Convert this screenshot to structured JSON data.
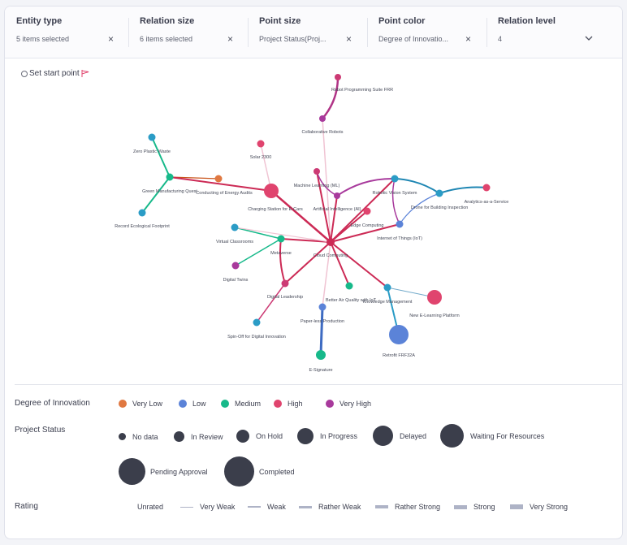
{
  "filters": [
    {
      "title": "Entity type",
      "value": "5 items selected",
      "control": "×"
    },
    {
      "title": "Relation size",
      "value": "6 items selected",
      "control": "×"
    },
    {
      "title": "Point size",
      "value": "Project Status(Proj...",
      "control": "×"
    },
    {
      "title": "Point color",
      "value": "Degree of Innovatio...",
      "control": "×"
    },
    {
      "title": "Relation level",
      "value": "4",
      "control": "chevron-down-icon"
    }
  ],
  "graph": {
    "start_point_label": "Set start point",
    "nodes": [
      {
        "id": "robot-programming-suite",
        "label": "Robot Programming Suite FRR",
        "color": "#cc3a74"
      },
      {
        "id": "collaborative-robots",
        "label": "Collaborative Robots",
        "color": "#a83a9c"
      },
      {
        "id": "zero-plastic-waste",
        "label": "Zero Plastic Waste",
        "color": "#2b9cc6"
      },
      {
        "id": "solar-2300",
        "label": "Solar 2300",
        "color": "#e0446e"
      },
      {
        "id": "green-manufacturing",
        "label": "Green Manufacturing Quest",
        "color": "#17b98a"
      },
      {
        "id": "conducting-energy-audits",
        "label": "Conducting of Energy Audits",
        "color": "#e07841"
      },
      {
        "id": "charging-station",
        "label": "Charging Station for E-Cars",
        "color": "#e0446e"
      },
      {
        "id": "record-ecological-footprint",
        "label": "Record Ecological Footprint",
        "color": "#2b9cc6"
      },
      {
        "id": "machine-learning",
        "label": "Machine Learning (ML)",
        "color": "#cc3a74"
      },
      {
        "id": "artificial-intelligence",
        "label": "Artificial Intelligence (AI)",
        "color": "#a83a9c"
      },
      {
        "id": "robotic-vision-system",
        "label": "Robotic Vision System",
        "color": "#2b9cc6"
      },
      {
        "id": "drone-building-inspection",
        "label": "Drone for Building Inspection",
        "color": "#2b9cc6"
      },
      {
        "id": "analytics-as-a-service",
        "label": "Analytics-as-a-Service",
        "color": "#e0446e"
      },
      {
        "id": "edge-computing",
        "label": "Edge Computing",
        "color": "#e0446e"
      },
      {
        "id": "internet-of-things",
        "label": "Internet of Things (IoT)",
        "color": "#5b83d8"
      },
      {
        "id": "virtual-classrooms",
        "label": "Virtual Classrooms",
        "color": "#2b9cc6"
      },
      {
        "id": "metaverse",
        "label": "Metaverse",
        "color": "#17b98a"
      },
      {
        "id": "cloud-computing",
        "label": "Cloud Computing",
        "color": "#cc2a55"
      },
      {
        "id": "digital-twins",
        "label": "Digital Twins",
        "color": "#a83a9c"
      },
      {
        "id": "digital-leadership",
        "label": "Digital Leadership",
        "color": "#cc3a74"
      },
      {
        "id": "better-air-quality",
        "label": "Better Air Quality with IoT",
        "color": "#17b98a"
      },
      {
        "id": "knowledge-management",
        "label": "Knowledge Management",
        "color": "#2b9cc6"
      },
      {
        "id": "new-e-learning-platform",
        "label": "New E-Learning Platform",
        "color": "#e0446e"
      },
      {
        "id": "paper-less-production",
        "label": "Paper-less Production",
        "color": "#5b83d8"
      },
      {
        "id": "spin-off-digital-innovation",
        "label": "Spin-Off for Digital Innovation",
        "color": "#2b9cc6"
      },
      {
        "id": "retrofit-frf-32a",
        "label": "Retrofit FRF32A",
        "color": "#5b83d8"
      },
      {
        "id": "e-signature",
        "label": "E-Signature",
        "color": "#17b98a"
      }
    ]
  },
  "legend": {
    "degree_of_innovation": {
      "title": "Degree of Innovation",
      "items": [
        {
          "label": "Very Low",
          "color": "#e07841"
        },
        {
          "label": "Low",
          "color": "#5b83d8"
        },
        {
          "label": "Medium",
          "color": "#17b98a"
        },
        {
          "label": "High",
          "color": "#e0446e"
        },
        {
          "label": "Very High",
          "color": "#a83a9c"
        }
      ]
    },
    "project_status": {
      "title": "Project Status",
      "items": [
        {
          "label": "No data"
        },
        {
          "label": "In Review"
        },
        {
          "label": "On Hold"
        },
        {
          "label": "In Progress"
        },
        {
          "label": "Delayed"
        },
        {
          "label": "Waiting For Resources"
        },
        {
          "label": "Pending Approval"
        },
        {
          "label": "Completed"
        }
      ],
      "color": "#3b3e4b"
    },
    "rating": {
      "title": "Rating",
      "items": [
        {
          "label": "Unrated"
        },
        {
          "label": "Very Weak"
        },
        {
          "label": "Weak"
        },
        {
          "label": "Rather Weak"
        },
        {
          "label": "Rather Strong"
        },
        {
          "label": "Strong"
        },
        {
          "label": "Very Strong"
        }
      ],
      "color": "#aeb3c6"
    }
  }
}
